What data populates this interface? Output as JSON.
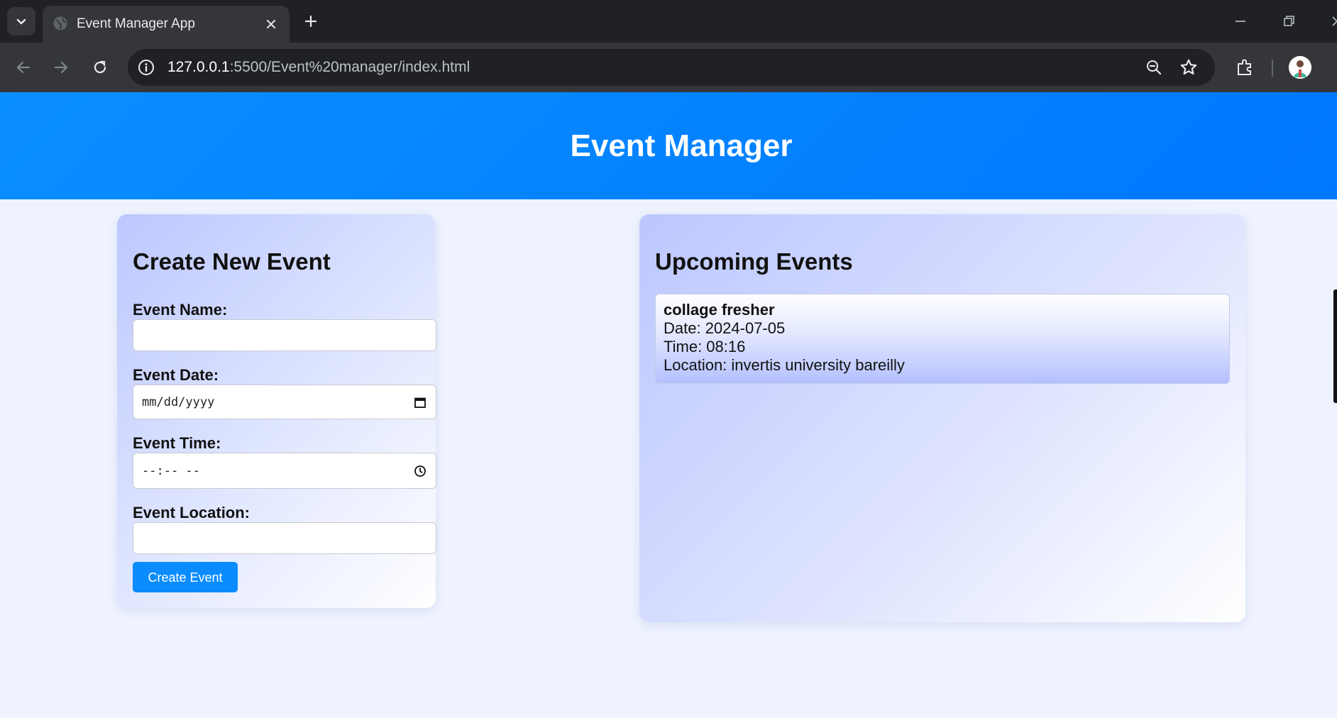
{
  "browser": {
    "tab_title": "Event Manager App",
    "url_host": "127.0.0.1",
    "url_rest": ":5500/Event%20manager/index.html",
    "icons": [
      "tab-list-icon",
      "globe-icon",
      "close-icon",
      "plus-icon",
      "minimize-icon",
      "restore-icon",
      "back-icon",
      "forward-icon",
      "reload-icon",
      "info-icon",
      "zoom-icon",
      "star-icon",
      "extensions-icon",
      "avatar"
    ]
  },
  "header": {
    "title": "Event Manager"
  },
  "form": {
    "heading": "Create New Event",
    "name_label": "Event Name:",
    "name_value": "",
    "date_label": "Event Date:",
    "date_placeholder": "mm/dd/yyyy",
    "time_label": "Event Time:",
    "time_placeholder": "--:-- --",
    "location_label": "Event Location:",
    "location_value": "",
    "submit_label": "Create Event"
  },
  "events": {
    "heading": "Upcoming Events",
    "items": [
      {
        "name": "collage fresher",
        "date": "Date: 2024-07-05",
        "time": "Time: 08:16",
        "location": "Location: invertis university bareilly"
      }
    ]
  },
  "colors": {
    "header_blue": "#0a8cff",
    "button_blue": "#0a8cff",
    "page_bg": "#eff3ff",
    "card_gradient_start": "#bcc7ff"
  }
}
